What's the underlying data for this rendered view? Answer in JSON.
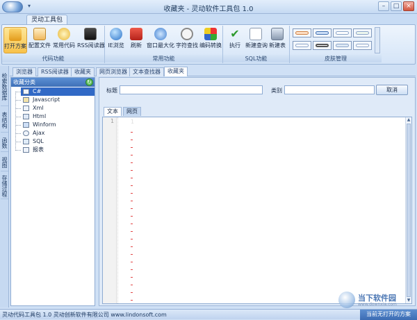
{
  "window": {
    "title": "收藏夹 - 灵动软件工具包 1.0"
  },
  "ribbon": {
    "tab": "灵动工具包",
    "groups": [
      {
        "label": "代码功能",
        "buttons": [
          "打开方案",
          "配置文件",
          "常用代码",
          "RSS阅读器"
        ]
      },
      {
        "label": "常用功能",
        "buttons": [
          "IE浏览",
          "刷新",
          "窗口最大化",
          "字符查找",
          "编码转换"
        ]
      },
      {
        "label": "SQL功能",
        "buttons": [
          "执行",
          "新建查询",
          "新建表"
        ]
      },
      {
        "label": "皮肤管理",
        "buttons": []
      }
    ]
  },
  "doc_tabs": [
    "浏览器",
    "RSS阅读器",
    "收藏夹",
    "网页浏览器",
    "文本查找器",
    "收藏夹"
  ],
  "side_items": [
    "检索数据库",
    "表结构",
    "函数",
    "视图",
    "存储过程"
  ],
  "left_panel": {
    "title": "收藏分类",
    "items": [
      "C#",
      "Javascript",
      "Xml",
      "Html",
      "Winform",
      "Ajax",
      "SQL",
      "报表"
    ]
  },
  "form": {
    "title_label": "标题",
    "category_label": "类别",
    "cancel_label": "取消",
    "title_value": "",
    "category_value": ""
  },
  "sub_tabs": [
    "文本",
    "网页"
  ],
  "editor": {
    "first_line": "1",
    "first_mark": "1"
  },
  "status": {
    "left": "灵动代码工具包 1.0   灵动创新软件有限公司  www.lindonsoft.com",
    "right": "当前无打开的方案"
  },
  "watermark": {
    "text": "当下软件园",
    "sub": "www.downxia.com"
  },
  "icons": [
    "app-orb-icon",
    "open-solution-icon",
    "config-file-icon",
    "common-code-icon",
    "rss-reader-icon",
    "ie-browse-icon",
    "refresh-icon",
    "maximize-window-icon",
    "search-text-icon",
    "encode-convert-icon",
    "execute-icon",
    "new-query-icon",
    "new-table-icon"
  ]
}
